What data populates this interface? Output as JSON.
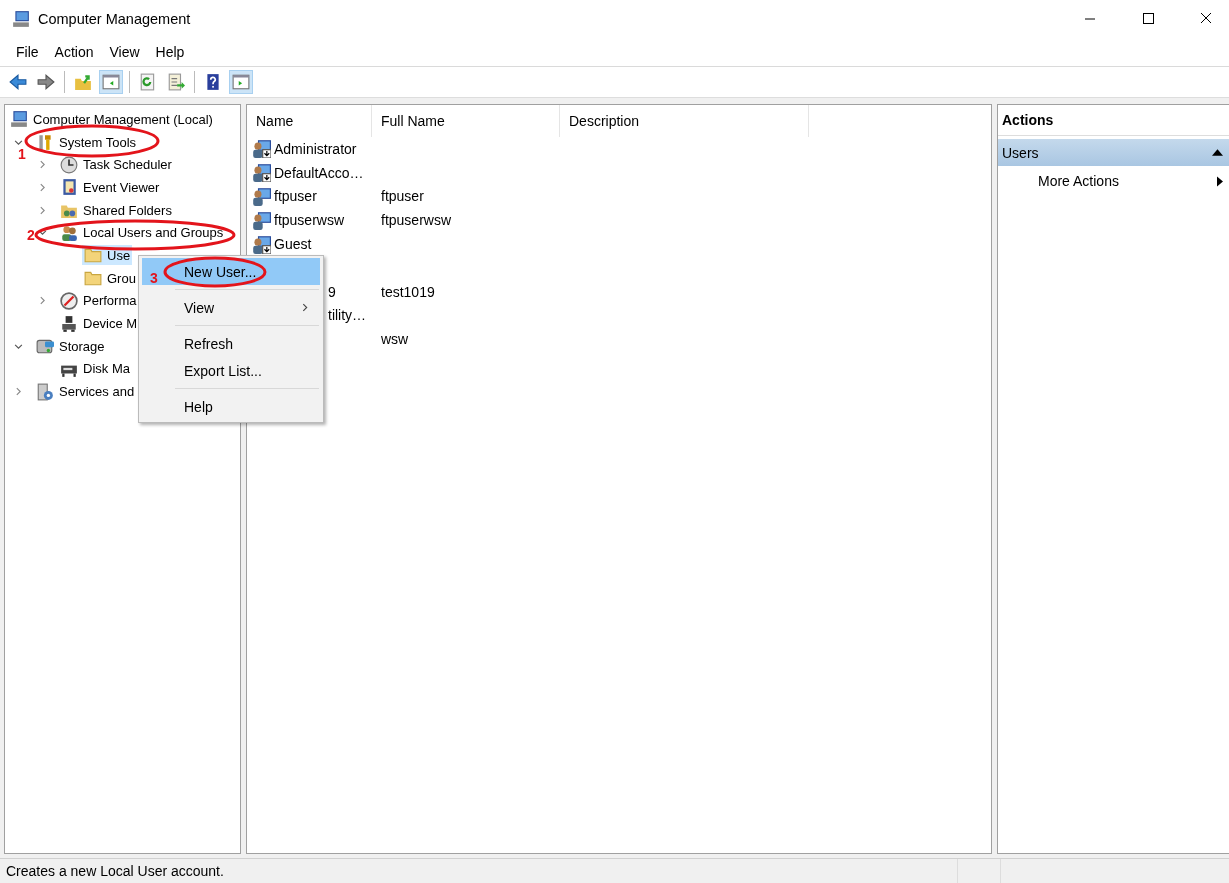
{
  "window": {
    "title": "Computer Management"
  },
  "menu_bar": [
    "File",
    "Action",
    "View",
    "Help"
  ],
  "toolbar": [
    {
      "kind": "button",
      "pressed": false
    },
    {
      "kind": "button",
      "pressed": false
    },
    {
      "kind": "separator"
    },
    {
      "kind": "button",
      "pressed": false
    },
    {
      "kind": "button",
      "pressed": true
    },
    {
      "kind": "separator"
    },
    {
      "kind": "button",
      "pressed": false
    },
    {
      "kind": "button",
      "pressed": false
    },
    {
      "kind": "separator"
    },
    {
      "kind": "button",
      "pressed": false
    },
    {
      "kind": "button",
      "pressed": true
    }
  ],
  "tree": [
    {
      "label": "Computer Management (Local)",
      "kind": "computer",
      "children": [
        {
          "label": "System Tools",
          "kind": "tools",
          "expanded": true,
          "children": [
            {
              "label": "Task Scheduler",
              "kind": "clock",
              "expanded": false
            },
            {
              "label": "Event Viewer",
              "kind": "log",
              "expanded": false
            },
            {
              "label": "Shared Folders",
              "kind": "share",
              "expanded": false
            },
            {
              "label": "Local Users and Groups",
              "kind": "users",
              "expanded": true,
              "children": [
                {
                  "label": "Use",
                  "kind": "folder",
                  "selected": true
                },
                {
                  "label": "Grou",
                  "kind": "folder",
                  "selected": false
                }
              ]
            },
            {
              "label": "Performa",
              "kind": "gauge",
              "expanded": false
            },
            {
              "label": "Device M",
              "kind": "device"
            }
          ]
        },
        {
          "label": "Storage",
          "kind": "storage",
          "expanded": true,
          "children": [
            {
              "label": "Disk Ma",
              "kind": "disk"
            }
          ]
        },
        {
          "label": "Services and",
          "kind": "services",
          "expanded": false
        }
      ]
    }
  ],
  "list": {
    "columns": [
      "Name",
      "Full Name",
      "Description"
    ],
    "rows": [
      {
        "kind": "user",
        "name": "Administrator",
        "disabled": true
      },
      {
        "kind": "user",
        "name": "DefaultAcco…",
        "disabled": true
      },
      {
        "kind": "user",
        "name": "ftpuser",
        "full_name": "ftpuser",
        "disabled": false
      },
      {
        "kind": "user",
        "name": "ftpuserwsw",
        "full_name": "ftpuserwsw",
        "disabled": false
      },
      {
        "kind": "user",
        "name": "Guest",
        "disabled": true
      },
      {
        "kind": "hidden"
      },
      {
        "kind": "partial",
        "name": "9",
        "full_name": "test1019"
      },
      {
        "kind": "partial",
        "name": "tility…"
      },
      {
        "kind": "partial",
        "full_name": "wsw"
      }
    ]
  },
  "context_menu": [
    {
      "kind": "item",
      "label": "New User...",
      "selected": true
    },
    {
      "kind": "separator"
    },
    {
      "kind": "item",
      "label": "View",
      "submenu": true,
      "selected": false
    },
    {
      "kind": "separator"
    },
    {
      "kind": "item",
      "label": "Refresh",
      "selected": false
    },
    {
      "kind": "item",
      "label": "Export List...",
      "selected": false
    },
    {
      "kind": "separator"
    },
    {
      "kind": "item",
      "label": "Help",
      "selected": false
    }
  ],
  "actions": {
    "title": "Actions",
    "sections": [
      {
        "label": "Users",
        "expanded": true,
        "items": [
          {
            "label": "More Actions",
            "submenu": true
          }
        ]
      }
    ]
  },
  "annotations": [
    {
      "number": "1"
    },
    {
      "number": "2"
    },
    {
      "number": "3"
    }
  ],
  "status_bar": "Creates a new Local User account."
}
